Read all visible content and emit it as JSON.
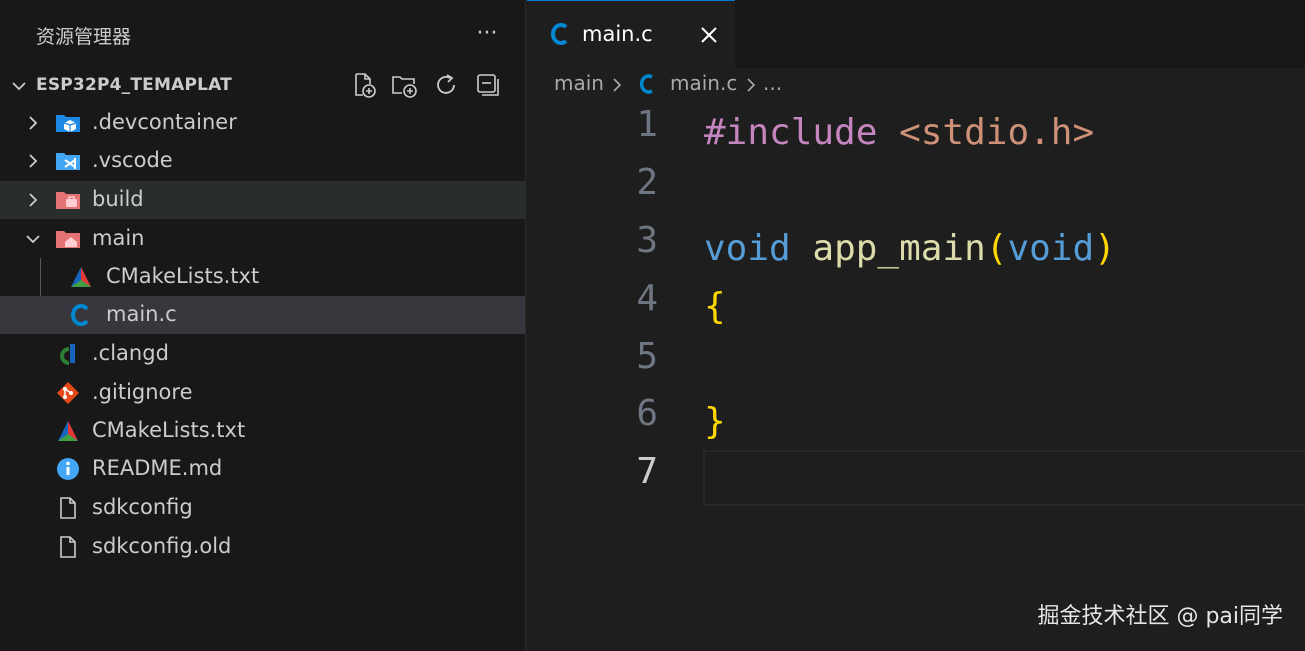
{
  "sidebar": {
    "title": "资源管理器",
    "more_label": "···",
    "section": {
      "title": "ESP32P4_TEMAPLAT"
    },
    "tools": [
      "new-file-icon",
      "new-folder-icon",
      "refresh-icon",
      "collapse-all-icon"
    ],
    "items": [
      {
        "label": ".devcontainer",
        "icon": "devcontainer-folder-icon",
        "expanded": false
      },
      {
        "label": ".vscode",
        "icon": "vscode-folder-icon",
        "expanded": false
      },
      {
        "label": "build",
        "icon": "build-folder-icon",
        "expanded": false
      },
      {
        "label": "main",
        "icon": "main-folder-icon",
        "expanded": true
      },
      {
        "label": "CMakeLists.txt",
        "icon": "cmake-icon"
      },
      {
        "label": "main.c",
        "icon": "c-file-icon",
        "selected": true
      },
      {
        "label": ".clangd",
        "icon": "clangd-icon"
      },
      {
        "label": ".gitignore",
        "icon": "git-icon"
      },
      {
        "label": "CMakeLists.txt",
        "icon": "cmake-icon"
      },
      {
        "label": "README.md",
        "icon": "info-icon"
      },
      {
        "label": "sdkconfig",
        "icon": "file-icon"
      },
      {
        "label": "sdkconfig.old",
        "icon": "file-icon"
      }
    ]
  },
  "editor": {
    "tab": {
      "label": "main.c",
      "icon": "c-file-icon",
      "close_icon": "close-icon"
    },
    "breadcrumb": {
      "folder": "main",
      "file": "main.c",
      "ellipsis": "..."
    },
    "lines": [
      {
        "number": "1",
        "tokens": [
          {
            "text": "#include",
            "color": "#c586c0"
          },
          {
            "text": " ",
            "color": "#d4d4d4"
          },
          {
            "text": "<stdio.h>",
            "color": "#ce9178"
          }
        ]
      },
      {
        "number": "2",
        "tokens": []
      },
      {
        "number": "3",
        "tokens": [
          {
            "text": "void",
            "color": "#569cd6"
          },
          {
            "text": " ",
            "color": "#d4d4d4"
          },
          {
            "text": "app_main",
            "color": "#dcdcaa"
          },
          {
            "text": "(",
            "color": "#ffd700"
          },
          {
            "text": "void",
            "color": "#569cd6"
          },
          {
            "text": ")",
            "color": "#ffd700"
          }
        ]
      },
      {
        "number": "4",
        "tokens": [
          {
            "text": "{",
            "color": "#ffd700"
          }
        ]
      },
      {
        "number": "5",
        "tokens": []
      },
      {
        "number": "6",
        "tokens": [
          {
            "text": "}",
            "color": "#ffd700"
          }
        ]
      },
      {
        "number": "7",
        "tokens": []
      }
    ],
    "active_line": "7"
  },
  "watermark": "掘金技术社区 @ pai同学",
  "colors": {
    "accent": "#0078d4",
    "c_icon": "#0288d1"
  }
}
